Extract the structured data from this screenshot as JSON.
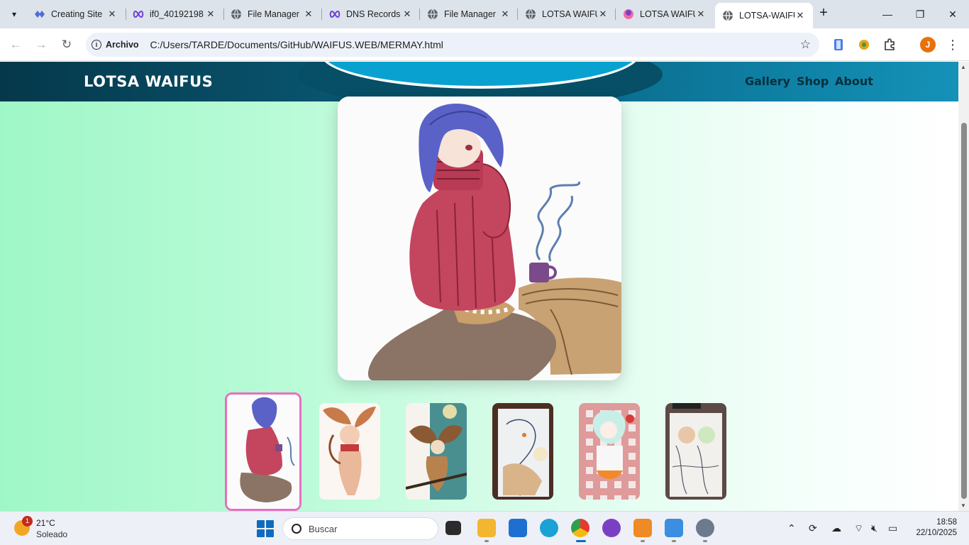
{
  "browser": {
    "tabs": [
      {
        "title": "Creating Site",
        "icon": "creating-site-icon"
      },
      {
        "title": "if0_40192198",
        "icon": "infinity-icon"
      },
      {
        "title": "File Manager",
        "icon": "globe-icon"
      },
      {
        "title": "DNS Records",
        "icon": "infinity-icon"
      },
      {
        "title": "File Manager",
        "icon": "globe-icon"
      },
      {
        "title": "LOTSA WAIFUS",
        "icon": "globe-icon"
      },
      {
        "title": "LOTSA WAIFUS",
        "icon": "waifu-icon"
      },
      {
        "title": "LOTSA-WAIFUS",
        "icon": "globe-icon",
        "active": true
      }
    ],
    "address": {
      "chip_label": "Archivo",
      "url": "C:/Users/TARDE/Documents/GitHub/WAIFUS.WEB/MERMAY.html"
    },
    "profile_initial": "J"
  },
  "site": {
    "brand": "LOTSA WAIFUS",
    "nav": [
      "Gallery",
      "Shop",
      "About"
    ],
    "main_image": "mermaid-in-red-sweater",
    "thumbnails": [
      "mermaid-red-sweater-thumb",
      "fox-girl-thumb",
      "owl-harpy-thumb",
      "sketch-mermaid-thumb",
      "gingham-girl-thumb",
      "sketchbook-thumb"
    ],
    "active_thumbnail": 0
  },
  "taskbar": {
    "weather": {
      "temp": "21°C",
      "condition": "Soleado",
      "badge": "1"
    },
    "search_placeholder": "Buscar",
    "apps": [
      "task-view",
      "file-explorer",
      "store",
      "edge",
      "chrome",
      "github-desktop",
      "sublime-text",
      "photos",
      "settings"
    ],
    "clock": {
      "time": "18:58",
      "date": "22/10/2025"
    }
  },
  "colors": {
    "header_dark": "#05384a",
    "header_light": "#1592b8",
    "oval_cyan": "#09a2d0",
    "page_mint": "#9ff7c7",
    "active_thumb_border": "#e86fc0"
  }
}
